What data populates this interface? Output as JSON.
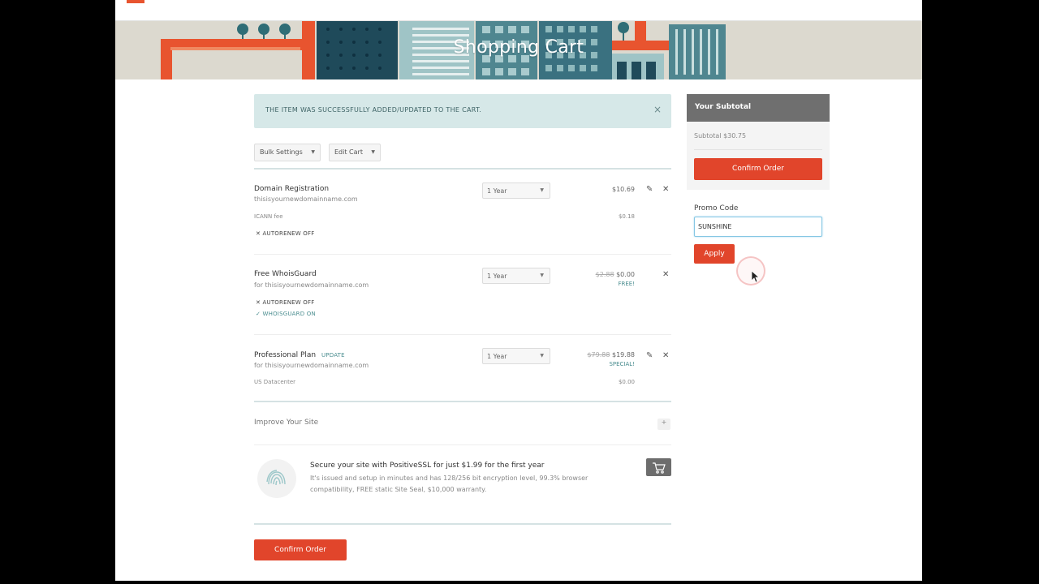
{
  "hero": {
    "title": "Shopping Cart"
  },
  "alert": {
    "text": "THE ITEM WAS SUCCESSFULLY ADDED/UPDATED TO THE CART.",
    "close_icon": "×"
  },
  "toolbar": {
    "bulk_settings": "Bulk Settings",
    "edit_cart": "Edit Cart",
    "caret": "▼"
  },
  "cart": {
    "items": [
      {
        "title": "Domain Registration",
        "subtitle": "thisisyournewdomainname.com",
        "period": "1 Year",
        "price": "$10.69",
        "fee_label": "ICANN fee",
        "fee_price": "$0.18",
        "autorenew": "AUTORENEW OFF",
        "edit_icon": "✎",
        "remove_icon": "✕"
      },
      {
        "title": "Free WhoisGuard",
        "subtitle": "for thisisyournewdomainname.com",
        "period": "1 Year",
        "old_price": "$2.88",
        "price": "$0.00",
        "note": "FREE!",
        "autorenew": "AUTORENEW OFF",
        "whoisguard": "WHOISGUARD ON",
        "remove_icon": "✕"
      },
      {
        "title": "Professional Plan",
        "update_link": "UPDATE",
        "subtitle": "for thisisyournewdomainname.com",
        "period": "1 Year",
        "old_price": "$79.88",
        "price": "$19.88",
        "note": "SPECIAL!",
        "extra_label": "US Datacenter",
        "extra_price": "$0.00",
        "edit_icon": "✎",
        "remove_icon": "✕"
      }
    ],
    "off_icon": "✕",
    "check_icon": "✓"
  },
  "improve": {
    "label": "Improve Your Site",
    "toggle": "+"
  },
  "upsell": {
    "title": "Secure your site with PositiveSSL for just $1.99 for the first year",
    "description": "It's issued and setup in minutes and has 128/256 bit encryption level, 99.3% browser compatibility, FREE static Site Seal, $10,000 warranty."
  },
  "buttons": {
    "confirm_order": "Confirm Order",
    "apply": "Apply"
  },
  "sidebar": {
    "heading": "Your Subtotal",
    "subtotal": "Subtotal $30.75",
    "promo_label": "Promo Code",
    "promo_value": "SUNSHINE"
  },
  "colors": {
    "accent": "#e1452b",
    "teal": "#4a8d8f",
    "alert_bg": "#d6e8e8"
  }
}
